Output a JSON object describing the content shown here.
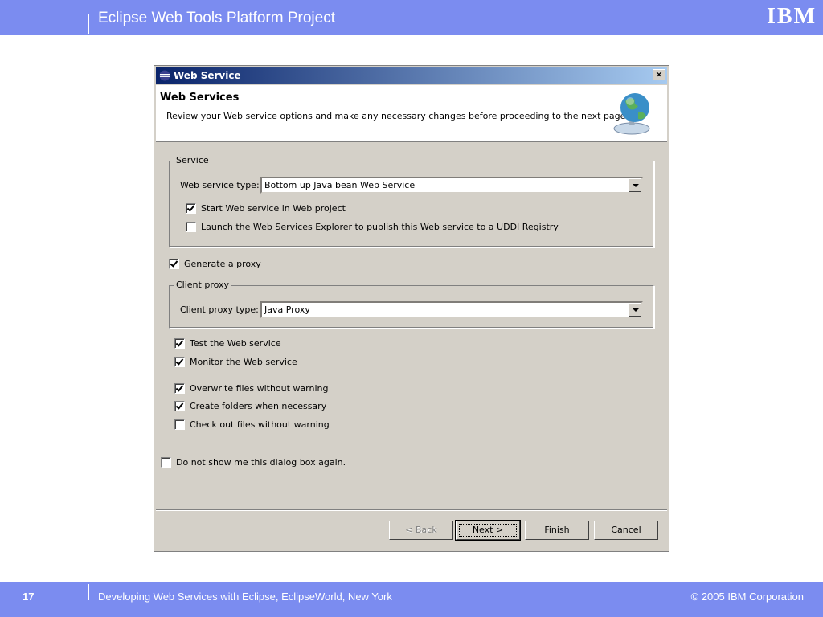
{
  "slide": {
    "header_title": "Eclipse Web Tools Platform Project",
    "logo_text": "IBM",
    "page_number": "17",
    "footer_text": "Developing Web Services with Eclipse, EclipseWorld, New York",
    "copyright": "© 2005 IBM Corporation"
  },
  "dialog": {
    "title": "Web Service",
    "close_label": "×",
    "banner_title": "Web Services",
    "banner_desc": "Review your Web service options and make any necessary changes before proceeding to the next page.",
    "service_group": {
      "legend": "Service",
      "type_label": "Web service type:",
      "type_value": "Bottom up Java bean Web Service",
      "options": [
        {
          "label": "Start Web service in Web project",
          "checked": true
        },
        {
          "label": "Launch the Web Services Explorer to publish this Web service to a UDDI Registry",
          "checked": false
        }
      ]
    },
    "generate_proxy": {
      "label": "Generate a proxy",
      "checked": true
    },
    "client_group": {
      "legend": "Client proxy",
      "type_label": "Client proxy type:",
      "type_value": "Java Proxy"
    },
    "test_options": [
      {
        "label": "Test the Web service",
        "checked": true
      },
      {
        "label": "Monitor the Web service",
        "checked": true
      }
    ],
    "file_options": [
      {
        "label": "Overwrite files without warning",
        "checked": true
      },
      {
        "label": "Create folders when necessary",
        "checked": true
      },
      {
        "label": "Check out files without warning",
        "checked": false
      }
    ],
    "do_not_show": {
      "label": "Do not show me this dialog box again.",
      "checked": false
    },
    "buttons": {
      "back": "< Back",
      "next": "Next >",
      "finish": "Finish",
      "cancel": "Cancel"
    }
  }
}
